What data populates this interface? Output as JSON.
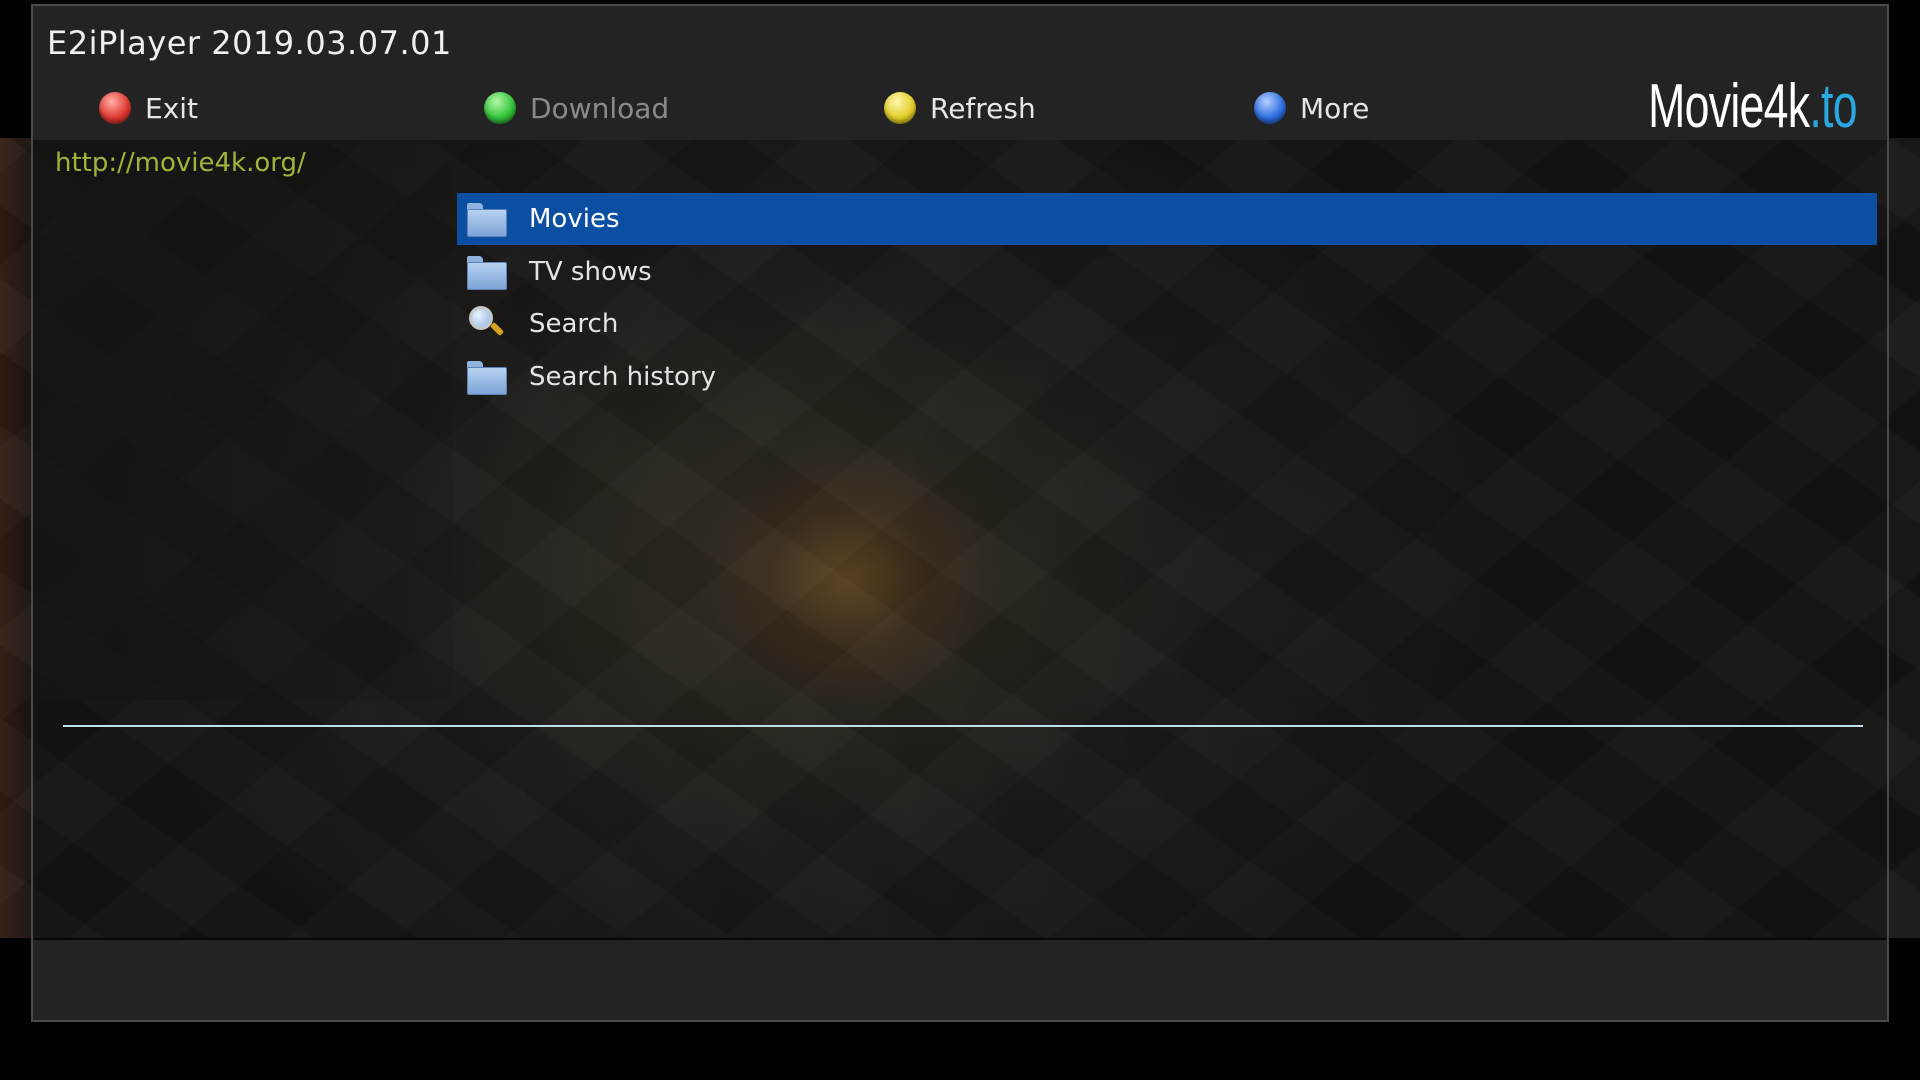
{
  "header": {
    "title": "E2iPlayer 2019.03.07.01",
    "buttons": [
      {
        "label": "Exit",
        "color": "#e03a32",
        "enabled": true
      },
      {
        "label": "Download",
        "color": "#33c43a",
        "enabled": false
      },
      {
        "label": "Refresh",
        "color": "#e3cf2a",
        "enabled": true
      },
      {
        "label": "More",
        "color": "#2f6fe0",
        "enabled": true
      }
    ],
    "logo": {
      "name": "Movie4k",
      "tld": ".to"
    }
  },
  "url": "http://movie4k.org/",
  "menu": {
    "items": [
      {
        "label": "Movies",
        "icon": "folder-icon",
        "selected": true
      },
      {
        "label": "TV shows",
        "icon": "folder-icon",
        "selected": false
      },
      {
        "label": "Search",
        "icon": "magnifier-icon",
        "selected": false
      },
      {
        "label": "Search history",
        "icon": "folder-icon",
        "selected": false
      }
    ]
  },
  "colors": {
    "selection": "#0a4fa2",
    "url_text": "#9fb53a",
    "divider": "#bfe0ea",
    "logo_tld": "#29a8e0"
  }
}
